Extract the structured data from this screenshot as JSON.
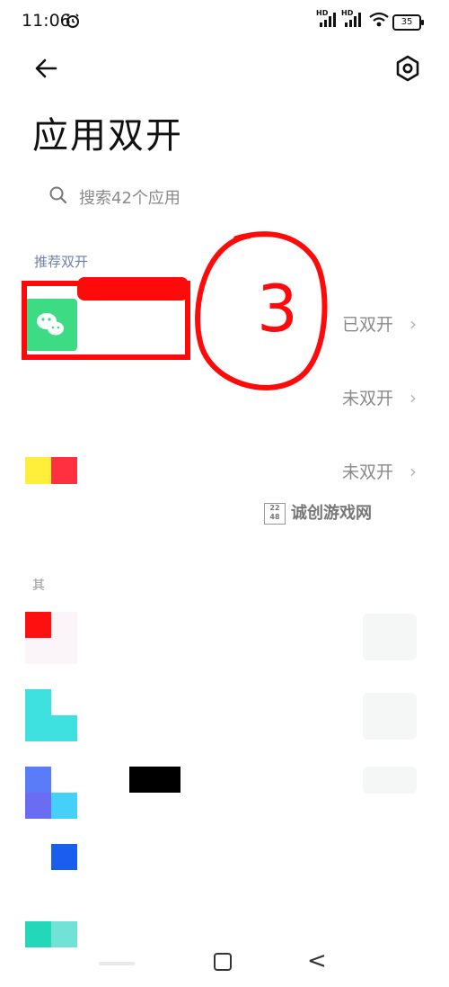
{
  "status_bar": {
    "time": "11:06",
    "hd1": "HD",
    "hd2": "HD",
    "battery": "35"
  },
  "header": {
    "title": "应用双开"
  },
  "search": {
    "placeholder": "搜索42个应用"
  },
  "recommended": {
    "label": "推荐双开",
    "items": [
      {
        "status": "已双开",
        "icon_color": "#3ddc84"
      },
      {
        "status": "未双开",
        "icon_color": "#ffffff"
      },
      {
        "status": "未双开",
        "icon_colors": [
          "#ffef3a",
          "#ff3040"
        ]
      }
    ]
  },
  "other_section": {
    "label": "其"
  },
  "watermark": {
    "logo": "22 48",
    "text": "诚创游戏网"
  },
  "annotation": {
    "text": "3"
  },
  "nav": {
    "back_glyph": "<"
  }
}
